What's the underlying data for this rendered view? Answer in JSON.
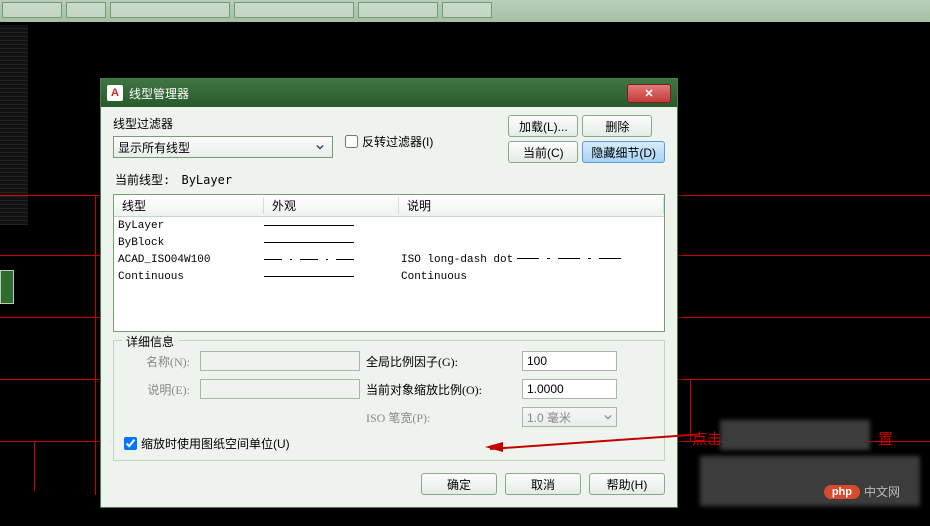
{
  "dialog": {
    "title": "线型管理器",
    "filter": {
      "label": "线型过滤器",
      "selected": "显示所有线型",
      "invert_label": "反转过滤器(I)",
      "invert_checked": false
    },
    "buttons": {
      "load": "加载(L)...",
      "delete": "删除",
      "current": "当前(C)",
      "hide_details": "隐藏细节(D)"
    },
    "current_linetype": {
      "label": "当前线型:",
      "value": "ByLayer"
    },
    "columns": {
      "name": "线型",
      "appearance": "外观",
      "desc": "说明"
    },
    "rows": [
      {
        "name": "ByLayer",
        "swatch": "solid",
        "desc": ""
      },
      {
        "name": "ByBlock",
        "swatch": "solid",
        "desc": ""
      },
      {
        "name": "ACAD_ISO04W100",
        "swatch": "dash",
        "desc": "ISO long-dash dot",
        "sample": true
      },
      {
        "name": "Continuous",
        "swatch": "solid",
        "desc": "Continuous"
      }
    ],
    "details": {
      "legend": "详细信息",
      "name_label": "名称(N):",
      "name_value": "",
      "desc_label": "说明(E):",
      "desc_value": "",
      "global_label": "全局比例因子(G):",
      "global_value": "100",
      "object_label": "当前对象缩放比例(O):",
      "object_value": "1.0000",
      "iso_label": "ISO 笔宽(P):",
      "iso_value": "1.0 毫米",
      "usepaper_label": "缩放时使用图纸空间单位(U)",
      "usepaper_checked": true
    },
    "footer": {
      "ok": "确定",
      "cancel": "取消",
      "help": "帮助(H)"
    }
  },
  "annotations": {
    "red_text": "点击",
    "red_text2": "置"
  },
  "watermark": {
    "brand": "php",
    "cn": "中文网"
  }
}
